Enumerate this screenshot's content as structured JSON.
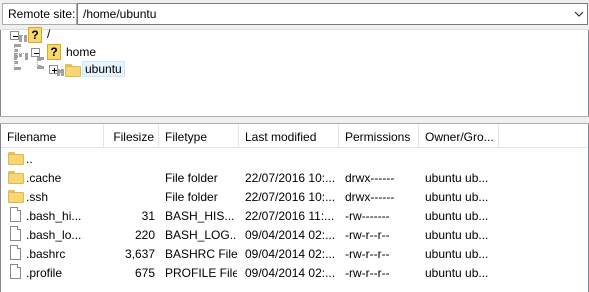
{
  "site_bar": {
    "label": "Remote site:",
    "path": "/home/ubuntu"
  },
  "tree": {
    "nodes": [
      {
        "label": "/",
        "icon": "question-folder-icon",
        "expander": "minus"
      },
      {
        "label": "home",
        "icon": "question-folder-icon",
        "expander": "minus"
      },
      {
        "label": "ubuntu",
        "icon": "folder-icon",
        "expander": "plus",
        "selected": true
      }
    ]
  },
  "list": {
    "columns": [
      "Filename",
      "Filesize",
      "Filetype",
      "Last modified",
      "Permissions",
      "Owner/Gro..."
    ],
    "rows": [
      {
        "name": "..",
        "size": "",
        "type": "",
        "modified": "",
        "perms": "",
        "owner": "",
        "icon": "folder-icon"
      },
      {
        "name": ".cache",
        "size": "",
        "type": "File folder",
        "modified": "22/07/2016 10:...",
        "perms": "drwx------",
        "owner": "ubuntu ub...",
        "icon": "folder-icon"
      },
      {
        "name": ".ssh",
        "size": "",
        "type": "File folder",
        "modified": "22/07/2016 10:...",
        "perms": "drwx------",
        "owner": "ubuntu ub...",
        "icon": "folder-icon"
      },
      {
        "name": ".bash_hi...",
        "size": "31",
        "type": "BASH_HIS...",
        "modified": "22/07/2016 11:...",
        "perms": "-rw-------",
        "owner": "ubuntu ub...",
        "icon": "file-icon"
      },
      {
        "name": ".bash_lo...",
        "size": "220",
        "type": "BASH_LOG...",
        "modified": "09/04/2014 02:...",
        "perms": "-rw-r--r--",
        "owner": "ubuntu ub...",
        "icon": "file-icon"
      },
      {
        "name": ".bashrc",
        "size": "3,637",
        "type": "BASHRC File",
        "modified": "09/04/2014 02:...",
        "perms": "-rw-r--r--",
        "owner": "ubuntu ub...",
        "icon": "file-icon"
      },
      {
        "name": ".profile",
        "size": "675",
        "type": "PROFILE File",
        "modified": "09/04/2014 02:...",
        "perms": "-rw-r--r--",
        "owner": "ubuntu ub...",
        "icon": "file-icon"
      }
    ]
  },
  "colors": {
    "folder": "#f7d674",
    "selection": "#e5f3ff",
    "chrome": "#f0f0f0"
  }
}
